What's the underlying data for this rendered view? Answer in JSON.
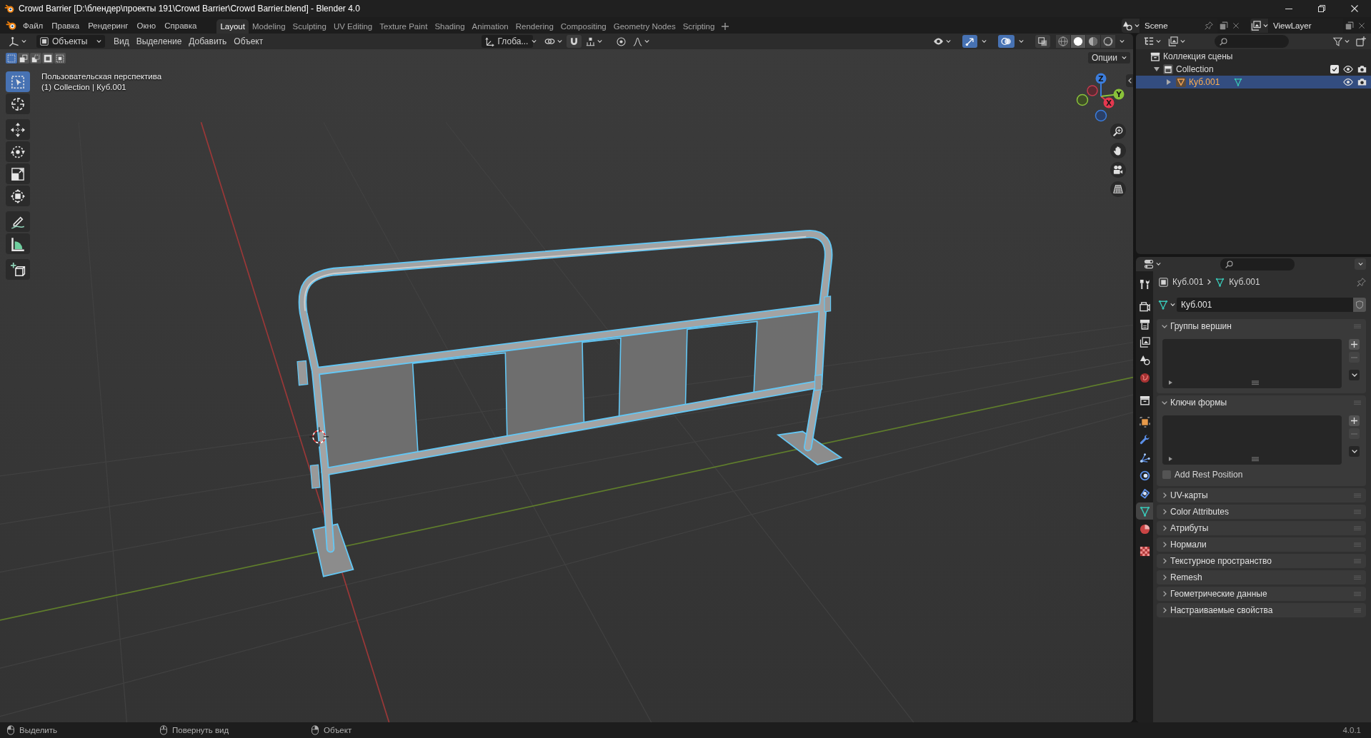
{
  "window": {
    "title": "Crowd Barrier [D:\\блендер\\проекты 191\\Crowd Barrier\\Crowd Barrier.blend] - Blender 4.0"
  },
  "menus": [
    "Файл",
    "Правка",
    "Рендеринг",
    "Окно",
    "Справка"
  ],
  "workspaces": [
    {
      "label": "Layout",
      "selected": true
    },
    {
      "label": "Modeling",
      "selected": false
    },
    {
      "label": "Sculpting",
      "selected": false
    },
    {
      "label": "UV Editing",
      "selected": false
    },
    {
      "label": "Texture Paint",
      "selected": false
    },
    {
      "label": "Shading",
      "selected": false
    },
    {
      "label": "Animation",
      "selected": false
    },
    {
      "label": "Rendering",
      "selected": false
    },
    {
      "label": "Compositing",
      "selected": false
    },
    {
      "label": "Geometry Nodes",
      "selected": false
    },
    {
      "label": "Scripting",
      "selected": false
    }
  ],
  "scene": {
    "name": "Scene",
    "view_layer": "ViewLayer"
  },
  "viewport": {
    "mode": "Объекты",
    "menus": [
      "Вид",
      "Выделение",
      "Добавить",
      "Объект"
    ],
    "orientation": "Глоба...",
    "toggles": {
      "gizmos": true,
      "overlays": true,
      "xray": false
    },
    "shading": [
      {
        "kind": "wireframe",
        "selected": false
      },
      {
        "kind": "solid",
        "selected": true
      },
      {
        "kind": "material",
        "selected": false
      },
      {
        "kind": "rendered",
        "selected": false
      }
    ],
    "options": "Опции",
    "select_modes": [
      {
        "kind": "set",
        "selected": true
      },
      {
        "kind": "extend",
        "selected": false
      },
      {
        "kind": "subtract",
        "selected": false
      },
      {
        "kind": "invert",
        "selected": false
      },
      {
        "kind": "intersect",
        "selected": false
      }
    ],
    "tool_groups": [
      {
        "tools": [
          {
            "kind": "select_box",
            "selected": true
          },
          {
            "kind": "cursor",
            "selected": false
          }
        ]
      },
      {
        "tools": [
          {
            "kind": "move",
            "selected": false
          },
          {
            "kind": "rotate",
            "selected": false
          },
          {
            "kind": "scale",
            "selected": false
          },
          {
            "kind": "transform",
            "selected": false
          }
        ]
      },
      {
        "tools": [
          {
            "kind": "annotate",
            "selected": false
          },
          {
            "kind": "measure",
            "selected": false
          }
        ]
      },
      {
        "tools": [
          {
            "kind": "add_cube",
            "selected": false
          }
        ]
      }
    ],
    "info": [
      "Пользовательская перспектива",
      "(1) Collection | Куб.001"
    ],
    "gizmo_axes": [
      {
        "kind": "z",
        "label": "Z"
      },
      {
        "kind": "y",
        "label": "Y"
      },
      {
        "kind": "x",
        "label": "X"
      }
    ]
  },
  "outliner": {
    "items": [
      {
        "label": "Коллекция сцены",
        "kind": "scene_collection",
        "selected": false,
        "children": [
          {
            "label": "Collection",
            "kind": "collection",
            "expanded": true,
            "selected": false,
            "checked": true,
            "visible": true,
            "renderable": true,
            "children": [
              {
                "label": "Куб.001",
                "kind": "mesh_object",
                "expanded": false,
                "selected": true,
                "visible": true,
                "renderable": true
              }
            ]
          }
        ]
      }
    ]
  },
  "properties": {
    "tab_groups": [
      {
        "tabs": [
          {
            "kind": "tool",
            "selected": false
          }
        ]
      },
      {
        "tabs": [
          {
            "kind": "render",
            "selected": false
          },
          {
            "kind": "output",
            "selected": false
          },
          {
            "kind": "view_layer",
            "selected": false
          },
          {
            "kind": "scene",
            "selected": false
          },
          {
            "kind": "world",
            "selected": false
          }
        ]
      },
      {
        "tabs": [
          {
            "kind": "collection",
            "selected": false
          }
        ]
      },
      {
        "tabs": [
          {
            "kind": "object",
            "selected": false
          },
          {
            "kind": "modifiers",
            "selected": false
          },
          {
            "kind": "particles",
            "selected": false
          },
          {
            "kind": "physics",
            "selected": false
          },
          {
            "kind": "constraints",
            "selected": false
          },
          {
            "kind": "data",
            "selected": true
          },
          {
            "kind": "material",
            "selected": false
          }
        ]
      },
      {
        "tabs": [
          {
            "kind": "texture",
            "selected": false
          }
        ]
      }
    ],
    "breadcrumb": [
      {
        "kind": "object",
        "label": "Куб.001"
      },
      {
        "kind": "mesh",
        "label": "Куб.001"
      }
    ],
    "datablock": "Куб.001",
    "panels": [
      {
        "title": "Группы вершин",
        "expanded": true,
        "kind": "list"
      },
      {
        "title": "Ключи формы",
        "expanded": true,
        "kind": "list",
        "checkbox": {
          "label": "Add Rest Position",
          "checked": false
        }
      },
      {
        "title": "UV-карты",
        "expanded": false
      },
      {
        "title": "Color Attributes",
        "expanded": false
      },
      {
        "title": "Атрибуты",
        "expanded": false
      },
      {
        "title": "Нормали",
        "expanded": false
      },
      {
        "title": "Текстурное пространство",
        "expanded": false
      },
      {
        "title": "Remesh",
        "expanded": false
      },
      {
        "title": "Геометрические данные",
        "expanded": false
      },
      {
        "title": "Настраиваемые свойства",
        "expanded": false
      }
    ]
  },
  "status_bar": {
    "hints": [
      {
        "kind": "left",
        "label": "Выделить"
      },
      {
        "kind": "middle",
        "label": "Повернуть вид"
      },
      {
        "kind": "right",
        "label": "Объект"
      }
    ],
    "version": "4.0.1"
  }
}
